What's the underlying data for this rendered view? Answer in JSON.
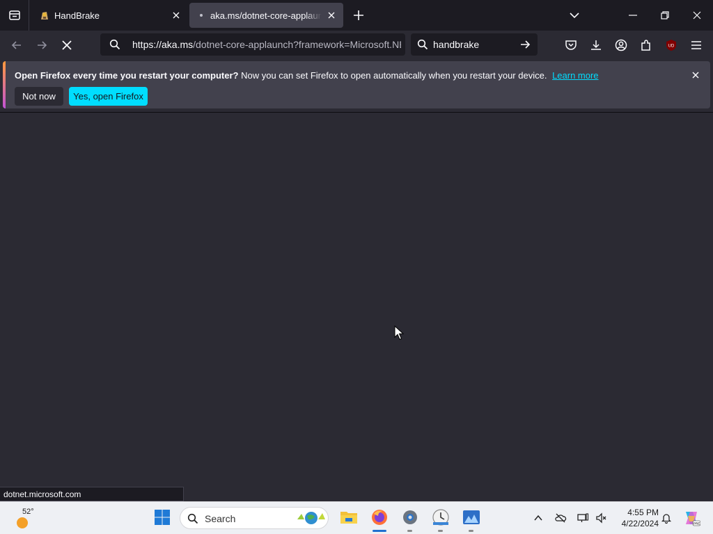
{
  "tabs": [
    {
      "title": "HandBrake",
      "active": false
    },
    {
      "title": "aka.ms/dotnet-core-applaunch?framework=Microsoft.NETCore.App",
      "active": true
    }
  ],
  "toolbar": {
    "url_host": "https://aka.ms",
    "url_rest": "/dotnet-core-applaunch?framework=Microsoft.NETCore.App",
    "search_value": "handbrake",
    "icons": [
      "back-icon",
      "forward-icon",
      "stop-loading-icon",
      "pocket-icon",
      "downloads-icon",
      "account-icon",
      "extensions-icon",
      "ublock-icon",
      "menu-icon"
    ]
  },
  "notification": {
    "title": "Open Firefox every time you restart your computer?",
    "message": "Now you can set Firefox to open automatically when you restart your device.",
    "link": "Learn more",
    "btn_dismiss": "Not now",
    "btn_accept": "Yes, open Firefox"
  },
  "status_text": "dotnet.microsoft.com",
  "taskbar": {
    "weather_temp": "52°",
    "search_label": "Search",
    "time": "4:55 PM",
    "date": "4/22/2024",
    "apps": [
      "windows-start",
      "file-explorer",
      "firefox",
      "settings",
      "clock-app",
      "photos"
    ]
  },
  "colors": {
    "accent": "#00ddff",
    "tab_bg": "#1c1b22",
    "toolbar_bg": "#2b2a33",
    "notif_bg": "#42414d"
  }
}
